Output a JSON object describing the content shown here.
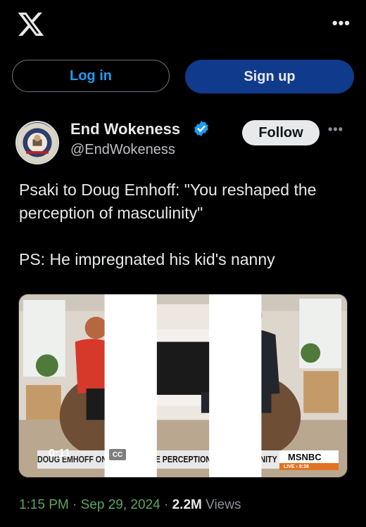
{
  "topbar": {
    "logo_icon": "x-logo-icon",
    "more_label": "•••"
  },
  "auth": {
    "login_label": "Log in",
    "signup_label": "Sign up"
  },
  "post": {
    "author_name": "End Wokeness",
    "author_handle": "@EndWokeness",
    "verified": true,
    "follow_label": "Follow",
    "more_label": "•••",
    "text_line1": "Psaki to Doug Emhoff: \"You reshaped the perception of masculinity\"",
    "text_line2": "PS: He impregnated his kid's nanny",
    "video": {
      "time": "0:11",
      "cc_label": "CC",
      "lower_third_prefix": "DOUG EMHOFF ON RE",
      "lower_third": "SHAPING THE PERCEPTION OF MASCULINITY",
      "network": "MSNBC",
      "live_label": "LIVE  ›  9:38"
    },
    "meta": {
      "time": "1:15 PM",
      "sep1": " · ",
      "date": "Sep 29, 2024",
      "sep2": " · ",
      "views_count": "2.2M",
      "views_label": " Views"
    }
  },
  "colors": {
    "link": "#1d9bf0",
    "signup_bg": "#103a8c",
    "verified": "#1d9bf0",
    "meta_green": "#5fa35f"
  }
}
